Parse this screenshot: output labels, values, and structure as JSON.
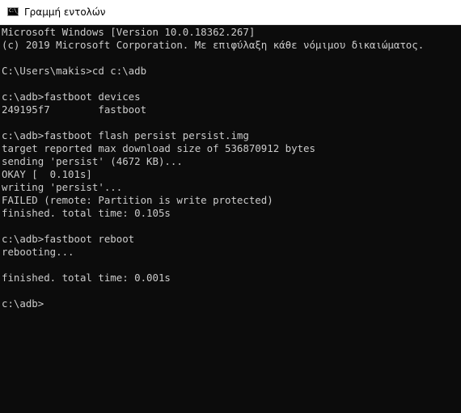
{
  "window": {
    "title": "Γραμμή εντολών",
    "icon": "cmd-icon",
    "icon_text": "C:\\_"
  },
  "console": {
    "lines": [
      "Microsoft Windows [Version 10.0.18362.267]",
      "(c) 2019 Microsoft Corporation. Με επιφύλαξη κάθε νόμιμου δικαιώματος.",
      "",
      "C:\\Users\\makis>cd c:\\adb",
      "",
      "c:\\adb>fastboot devices",
      "249195f7        fastboot",
      "",
      "c:\\adb>fastboot flash persist persist.img",
      "target reported max download size of 536870912 bytes",
      "sending 'persist' (4672 KB)...",
      "OKAY [  0.101s]",
      "writing 'persist'...",
      "FAILED (remote: Partition is write protected)",
      "finished. total time: 0.105s",
      "",
      "c:\\adb>fastboot reboot",
      "rebooting...",
      "",
      "finished. total time: 0.001s",
      "",
      "c:\\adb>"
    ]
  },
  "colors": {
    "background": "#0c0c0c",
    "foreground": "#cccccc",
    "titlebar": "#ffffff"
  }
}
